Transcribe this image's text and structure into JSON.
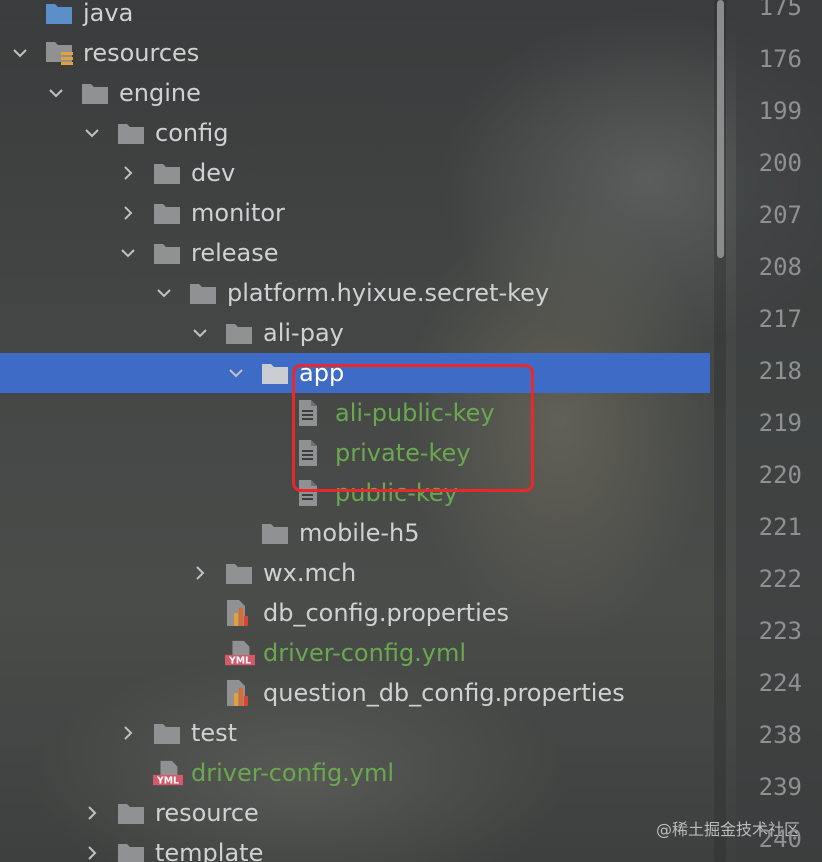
{
  "tree": {
    "items": [
      {
        "label": "java",
        "icon": "folder-blue-icon",
        "expanded": null,
        "depth": 1,
        "color": "default"
      },
      {
        "label": "resources",
        "icon": "resources-folder-icon",
        "expanded": true,
        "depth": 1,
        "color": "default"
      },
      {
        "label": "engine",
        "icon": "folder-icon",
        "expanded": true,
        "depth": 2,
        "color": "default"
      },
      {
        "label": "config",
        "icon": "folder-icon",
        "expanded": true,
        "depth": 3,
        "color": "default"
      },
      {
        "label": "dev",
        "icon": "folder-icon",
        "expanded": false,
        "depth": 4,
        "color": "default"
      },
      {
        "label": "monitor",
        "icon": "folder-icon",
        "expanded": false,
        "depth": 4,
        "color": "default"
      },
      {
        "label": "release",
        "icon": "folder-icon",
        "expanded": true,
        "depth": 4,
        "color": "default"
      },
      {
        "label": "platform.hyixue.secret-key",
        "icon": "folder-icon",
        "expanded": true,
        "depth": 5,
        "color": "default"
      },
      {
        "label": "ali-pay",
        "icon": "folder-icon",
        "expanded": true,
        "depth": 6,
        "color": "default"
      },
      {
        "label": "app",
        "icon": "folder-icon",
        "expanded": true,
        "depth": 7,
        "color": "white",
        "selected": true
      },
      {
        "label": "ali-public-key",
        "icon": "text-file-icon",
        "expanded": null,
        "depth": 8,
        "color": "green"
      },
      {
        "label": "private-key",
        "icon": "text-file-icon",
        "expanded": null,
        "depth": 8,
        "color": "green"
      },
      {
        "label": "public-key",
        "icon": "text-file-icon",
        "expanded": null,
        "depth": 8,
        "color": "green"
      },
      {
        "label": "mobile-h5",
        "icon": "folder-icon",
        "expanded": null,
        "depth": 7,
        "color": "default"
      },
      {
        "label": "wx.mch",
        "icon": "folder-icon",
        "expanded": false,
        "depth": 6,
        "color": "default"
      },
      {
        "label": "db_config.properties",
        "icon": "properties-file-icon",
        "expanded": null,
        "depth": 6,
        "color": "default"
      },
      {
        "label": "driver-config.yml",
        "icon": "yml-file-icon",
        "expanded": null,
        "depth": 6,
        "color": "green"
      },
      {
        "label": "question_db_config.properties",
        "icon": "properties-file-icon",
        "expanded": null,
        "depth": 6,
        "color": "default"
      },
      {
        "label": "test",
        "icon": "folder-icon",
        "expanded": false,
        "depth": 4,
        "color": "default"
      },
      {
        "label": "driver-config.yml",
        "icon": "yml-file-icon",
        "expanded": null,
        "depth": 4,
        "color": "green"
      },
      {
        "label": "resource",
        "icon": "folder-icon",
        "expanded": false,
        "depth": 3,
        "color": "default"
      },
      {
        "label": "template",
        "icon": "folder-icon",
        "expanded": false,
        "depth": 3,
        "color": "default"
      }
    ]
  },
  "gutter": {
    "line_numbers": [
      "175",
      "176",
      "199",
      "200",
      "207",
      "208",
      "217",
      "218",
      "219",
      "220",
      "221",
      "222",
      "223",
      "224",
      "238",
      "239",
      "240"
    ]
  },
  "yml_badge": "YML",
  "watermark": "@稀土掘金技术社区",
  "colors": {
    "selection": "#3d6bc5",
    "highlight_box": "#e8282a",
    "vcs_added": "#6aa84f",
    "text": "#cfd1d3"
  }
}
